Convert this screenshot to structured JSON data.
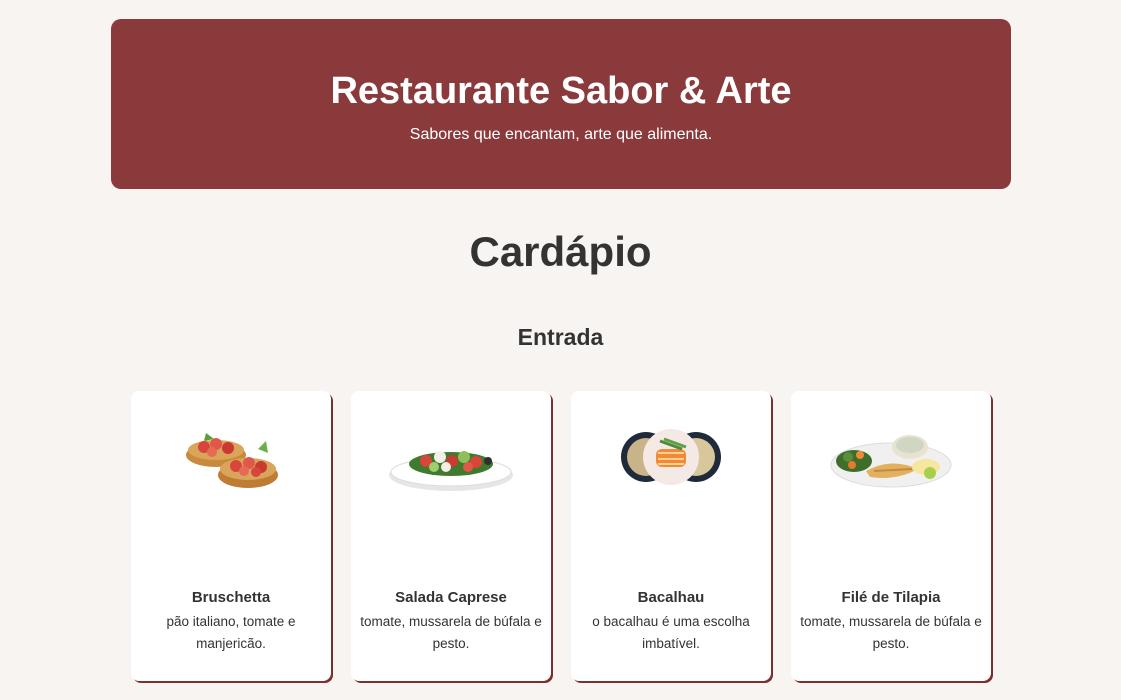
{
  "header": {
    "title": "Restaurante Sabor & Arte",
    "tagline": "Sabores que encantam, arte que alimenta."
  },
  "menu": {
    "title": "Cardápio",
    "section": "Entrada",
    "items": [
      {
        "name": "Bruschetta",
        "description": "pão italiano, tomate e manjericão.",
        "image": "bruschetta-image"
      },
      {
        "name": "Salada Caprese",
        "description": "tomate, mussarela de búfala e pesto.",
        "image": "caprese-salad-image"
      },
      {
        "name": "Bacalhau",
        "description": "o bacalhau é uma escolha imbatível.",
        "image": "bacalhau-image"
      },
      {
        "name": "Filé de Tilapia",
        "description": "tomate, mussarela de búfala e pesto.",
        "image": "tilapia-image"
      }
    ]
  },
  "colors": {
    "header_bg": "#8b3a3c",
    "page_bg": "#f8f4f1",
    "card_shadow": "#7a2f31",
    "text": "#333333"
  }
}
